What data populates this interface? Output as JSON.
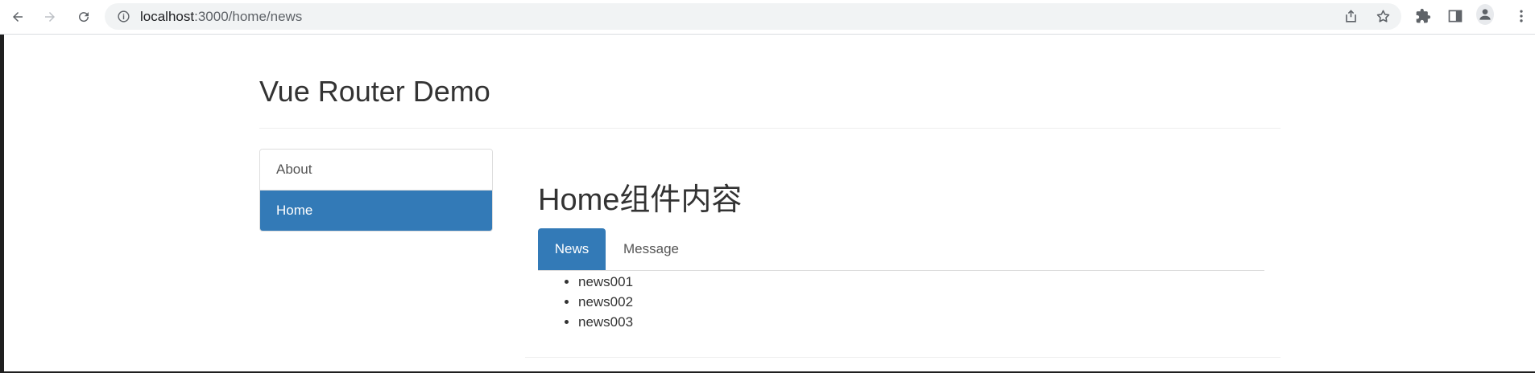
{
  "browser": {
    "url_host": "localhost",
    "url_path": ":3000/home/news",
    "icons": {
      "back": "back-arrow-icon",
      "forward": "forward-arrow-icon",
      "reload": "reload-icon",
      "info": "site-info-icon",
      "share": "share-icon",
      "bookmark": "bookmark-star-icon",
      "extensions": "puzzle-icon",
      "side_panel": "side-panel-icon",
      "profile": "profile-icon",
      "menu": "kebab-menu-icon"
    }
  },
  "page": {
    "title": "Vue Router Demo",
    "sidebar": {
      "items": [
        {
          "label": "About",
          "active": false
        },
        {
          "label": "Home",
          "active": true
        }
      ]
    },
    "home": {
      "heading": "Home组件内容",
      "tabs": [
        {
          "label": "News",
          "active": true
        },
        {
          "label": "Message",
          "active": false
        }
      ],
      "news": [
        "news001",
        "news002",
        "news003"
      ]
    }
  },
  "colors": {
    "accent": "#337ab7",
    "text": "#333333",
    "border": "#dddddd"
  }
}
